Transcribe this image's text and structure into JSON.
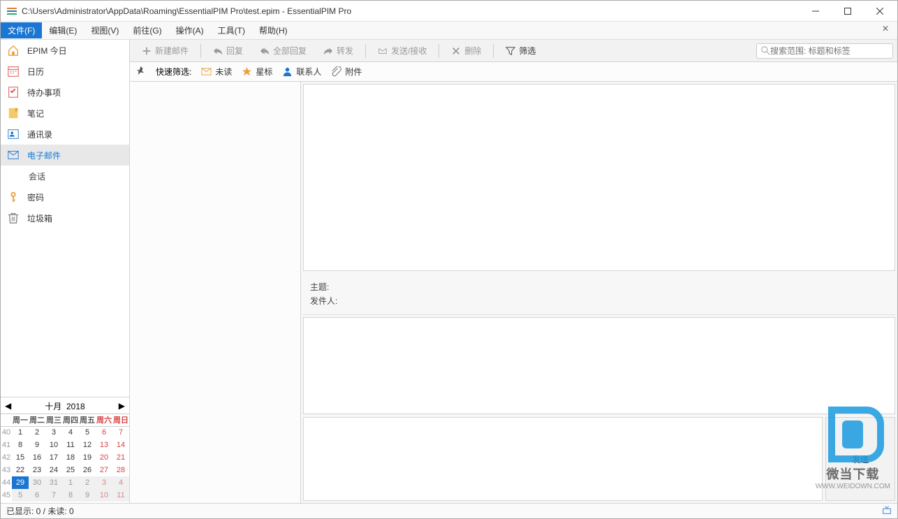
{
  "titlebar": {
    "title": "C:\\Users\\Administrator\\AppData\\Roaming\\EssentialPIM Pro\\test.epim - EssentialPIM Pro"
  },
  "menubar": {
    "items": [
      "文件(F)",
      "编辑(E)",
      "视图(V)",
      "前往(G)",
      "操作(A)",
      "工具(T)",
      "帮助(H)"
    ]
  },
  "sidebar": {
    "items": [
      {
        "icon": "home-icon",
        "label": "EPIM 今日"
      },
      {
        "icon": "calendar-icon",
        "label": "日历"
      },
      {
        "icon": "todo-icon",
        "label": "待办事项"
      },
      {
        "icon": "note-icon",
        "label": "笔记"
      },
      {
        "icon": "contacts-icon",
        "label": "通讯录"
      },
      {
        "icon": "mail-icon",
        "label": "电子邮件",
        "selected": true
      },
      {
        "icon": "",
        "label": "会话",
        "indent": true
      },
      {
        "icon": "password-icon",
        "label": "密码"
      },
      {
        "icon": "trash-icon",
        "label": "垃圾箱"
      }
    ]
  },
  "calendar": {
    "month": "十月",
    "year": "2018",
    "weekdays": [
      "周一",
      "周二",
      "周三",
      "周四",
      "周五",
      "周六",
      "周日"
    ],
    "weeks": [
      {
        "wk": "40",
        "days": [
          {
            "n": "1"
          },
          {
            "n": "2"
          },
          {
            "n": "3"
          },
          {
            "n": "4"
          },
          {
            "n": "5"
          },
          {
            "n": "6",
            "we": true
          },
          {
            "n": "7",
            "we": true
          }
        ]
      },
      {
        "wk": "41",
        "days": [
          {
            "n": "8"
          },
          {
            "n": "9"
          },
          {
            "n": "10"
          },
          {
            "n": "11"
          },
          {
            "n": "12"
          },
          {
            "n": "13",
            "we": true
          },
          {
            "n": "14",
            "we": true
          }
        ]
      },
      {
        "wk": "42",
        "days": [
          {
            "n": "15"
          },
          {
            "n": "16"
          },
          {
            "n": "17"
          },
          {
            "n": "18"
          },
          {
            "n": "19"
          },
          {
            "n": "20",
            "we": true
          },
          {
            "n": "21",
            "we": true
          }
        ]
      },
      {
        "wk": "43",
        "days": [
          {
            "n": "22"
          },
          {
            "n": "23"
          },
          {
            "n": "24"
          },
          {
            "n": "25"
          },
          {
            "n": "26"
          },
          {
            "n": "27",
            "we": true
          },
          {
            "n": "28",
            "we": true
          }
        ]
      },
      {
        "wk": "44",
        "days": [
          {
            "n": "29",
            "today": true
          },
          {
            "n": "30",
            "dim": true
          },
          {
            "n": "31",
            "dim": true
          },
          {
            "n": "1",
            "dim": true
          },
          {
            "n": "2",
            "dim": true
          },
          {
            "n": "3",
            "dim": true,
            "we": true
          },
          {
            "n": "4",
            "dim": true,
            "we": true
          }
        ]
      },
      {
        "wk": "45",
        "days": [
          {
            "n": "5",
            "dim": true
          },
          {
            "n": "6",
            "dim": true
          },
          {
            "n": "7",
            "dim": true
          },
          {
            "n": "8",
            "dim": true
          },
          {
            "n": "9",
            "dim": true
          },
          {
            "n": "10",
            "dim": true,
            "we": true
          },
          {
            "n": "11",
            "dim": true,
            "we": true
          }
        ]
      }
    ]
  },
  "toolbar": {
    "new": "新建邮件",
    "reply": "回复",
    "reply_all": "全部回复",
    "forward": "转发",
    "send_recv": "发送/接收",
    "delete": "删除",
    "filter": "筛选",
    "search_placeholder": "搜索范围: 标题和标签"
  },
  "filterbar": {
    "label": "快速筛选:",
    "unread": "未读",
    "starred": "星标",
    "contact": "联系人",
    "attach": "附件"
  },
  "preview": {
    "subject_label": "主题:",
    "from_label": "发件人:",
    "send_button": "发送"
  },
  "statusbar": {
    "shown": "已显示: 0",
    "unread": "未读: 0"
  },
  "watermark": {
    "text": "微当下载",
    "url": "WWW.WEIDOWN.COM"
  }
}
